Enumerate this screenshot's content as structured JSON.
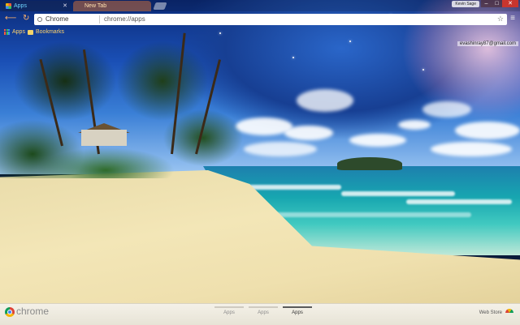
{
  "tabs": [
    {
      "label": "Apps",
      "active": true
    },
    {
      "label": "New Tab",
      "active": false
    }
  ],
  "window": {
    "profile_label": "Kevin Sage",
    "minimize": "–",
    "maximize": "□",
    "close": "✕"
  },
  "toolbar": {
    "back_icon": "back-arrow-icon",
    "reload_icon": "reload-icon",
    "omnibox_chip": "Chrome",
    "url": "chrome://apps",
    "star_icon": "star-icon"
  },
  "bookmarks": {
    "apps_label": "Apps",
    "bookmarks_label": "Bookmarks"
  },
  "account": {
    "email": "evashinray87@gmail.com"
  },
  "launcher": {
    "brand": "chrome",
    "pages": [
      {
        "label": "Apps",
        "active": false
      },
      {
        "label": "Apps",
        "active": false
      },
      {
        "label": "Apps",
        "active": true
      }
    ],
    "webstore_label": "Web Store"
  },
  "colors": {
    "tab_active_text": "#6fd6ff",
    "nav_icons": "#ffb36b",
    "bookmark_text": "#ffd36b",
    "window_close": "#c8352e"
  }
}
